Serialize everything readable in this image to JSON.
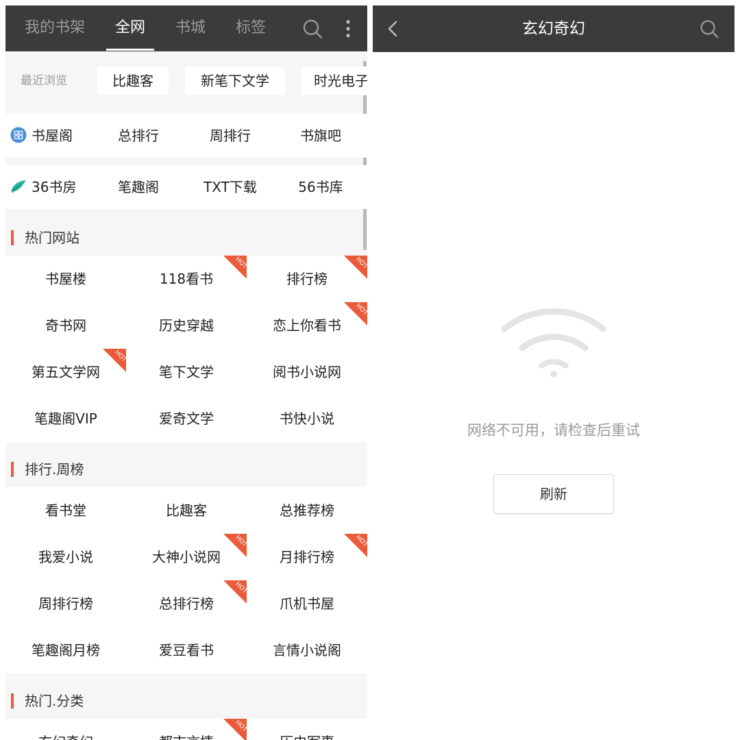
{
  "left": {
    "tabs": [
      {
        "label": "我的书架"
      },
      {
        "label": "全网"
      },
      {
        "label": "书城"
      },
      {
        "label": "标签"
      }
    ],
    "recent_label": "最近浏览",
    "recent": [
      "比趣客",
      "新笔下文学",
      "时光电子"
    ],
    "site_rows": [
      {
        "logo": "grid-app-icon",
        "items": [
          "书屋阁",
          "总排行",
          "周排行",
          "书旗吧"
        ]
      },
      {
        "logo": "leaf-logo-icon",
        "items": [
          "36书房",
          "笔趣阁",
          "TXT下载",
          "56书库"
        ]
      }
    ],
    "hot_badge": "HOT",
    "sections": [
      {
        "title": "热门网站",
        "items": [
          {
            "label": "书屋楼",
            "hot": false
          },
          {
            "label": "118看书",
            "hot": true
          },
          {
            "label": "排行榜",
            "hot": true
          },
          {
            "label": "奇书网",
            "hot": false
          },
          {
            "label": "历史穿越",
            "hot": false
          },
          {
            "label": "恋上你看书",
            "hot": true
          },
          {
            "label": "第五文学网",
            "hot": true
          },
          {
            "label": "笔下文学",
            "hot": false
          },
          {
            "label": "阅书小说网",
            "hot": false
          },
          {
            "label": "笔趣阁VIP",
            "hot": false
          },
          {
            "label": "爱奇文学",
            "hot": false
          },
          {
            "label": "书快小说",
            "hot": false
          }
        ]
      },
      {
        "title": "排行.周榜",
        "items": [
          {
            "label": "看书堂",
            "hot": false
          },
          {
            "label": "比趣客",
            "hot": false
          },
          {
            "label": "总推荐榜",
            "hot": false
          },
          {
            "label": "我爱小说",
            "hot": false
          },
          {
            "label": "大神小说网",
            "hot": true
          },
          {
            "label": "月排行榜",
            "hot": true
          },
          {
            "label": "周排行榜",
            "hot": false
          },
          {
            "label": "总排行榜",
            "hot": true
          },
          {
            "label": "爪机书屋",
            "hot": false
          },
          {
            "label": "笔趣阁月榜",
            "hot": false
          },
          {
            "label": "爱豆看书",
            "hot": false
          },
          {
            "label": "言情小说阁",
            "hot": false
          }
        ]
      },
      {
        "title": "热门.分类",
        "items": [
          {
            "label": "玄幻奇幻",
            "hot": false
          },
          {
            "label": "都市言情",
            "hot": true
          },
          {
            "label": "历史军事",
            "hot": false
          }
        ]
      }
    ]
  },
  "right": {
    "title": "玄幻奇幻",
    "error_message": "网络不可用，请检查后重试",
    "refresh_label": "刷新"
  },
  "colors": {
    "header_bg": "#3b3b3b",
    "accent": "#e85a3c",
    "hot_badge": "#ea5b3a"
  }
}
